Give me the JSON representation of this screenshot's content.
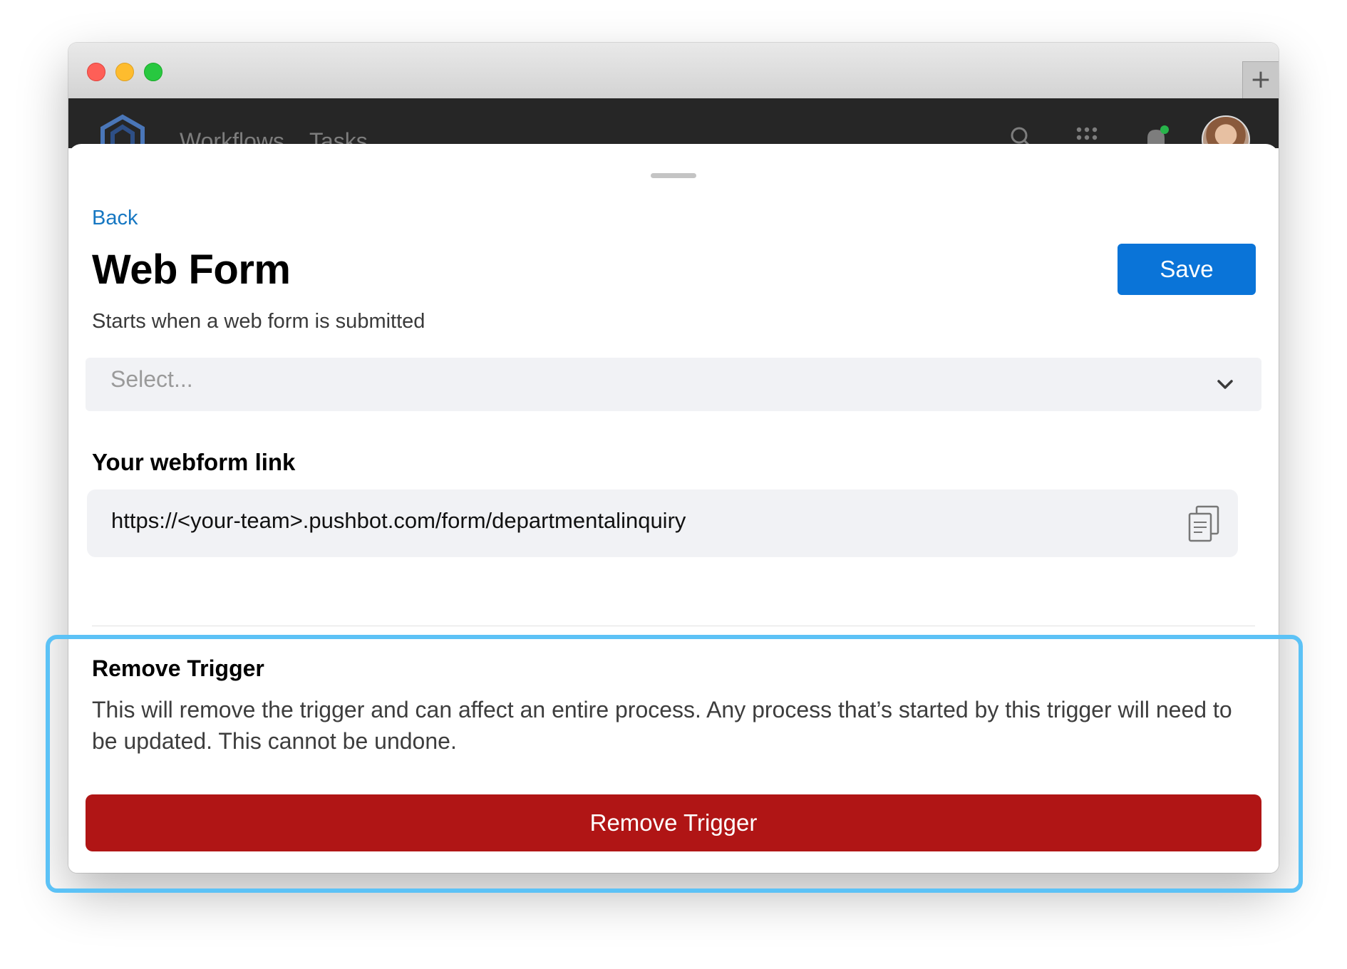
{
  "window": {
    "controls": [
      "close",
      "minimize",
      "maximize"
    ],
    "new_tab_label": "+"
  },
  "app_bar": {
    "nav": [
      {
        "label": "Workflows"
      },
      {
        "label": "Tasks"
      }
    ],
    "icons": [
      "search-icon",
      "apps-grid-icon",
      "bell-icon"
    ]
  },
  "sheet": {
    "back_label": "Back",
    "title": "Web Form",
    "save_label": "Save",
    "subtitle": "Starts when a web form is submitted",
    "select": {
      "placeholder": "Select..."
    },
    "webform": {
      "heading": "Your webform link",
      "url": "https://<your-team>.pushbot.com/form/departmentalinquiry",
      "copy_icon": "copy-icon"
    },
    "remove": {
      "heading": "Remove Trigger",
      "description": "This will remove the trigger and can affect an entire process. Any process that’s started by this trigger will need to be updated. This cannot be undone.",
      "button_label": "Remove Trigger"
    }
  },
  "colors": {
    "accent": "#0a74d8",
    "link": "#1677c2",
    "danger": "#b01515",
    "highlight": "#5cc2f6",
    "appbar": "#262626"
  }
}
